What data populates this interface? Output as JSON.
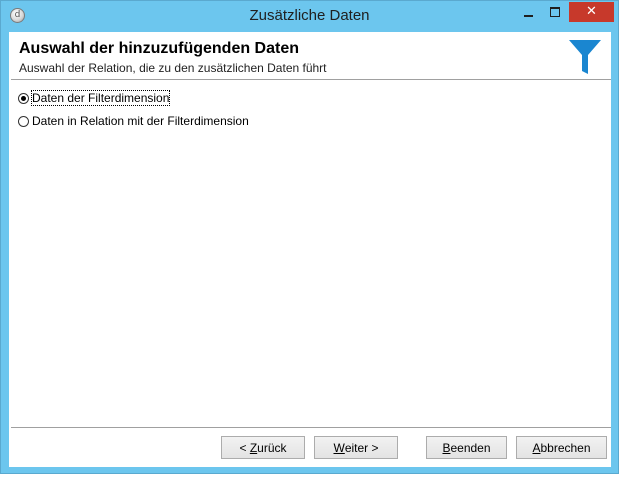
{
  "window": {
    "title": "Zusätzliche Daten",
    "controls": {
      "minimize": "minimize",
      "maximize": "maximize",
      "close": "✕"
    }
  },
  "header": {
    "title": "Auswahl der hinzuzufügenden Daten",
    "subtitle": "Auswahl der Relation, die zu den zusätzlichen Daten führt",
    "icon": "filter-icon",
    "icon_color": "#1a86d0"
  },
  "options": [
    {
      "label": "Daten der Filterdimension",
      "selected": true
    },
    {
      "label": "Daten in Relation mit der Filterdimension",
      "selected": false
    }
  ],
  "buttons": {
    "back": {
      "prefix": "< ",
      "mnemonic": "Z",
      "rest": "urück"
    },
    "next": {
      "prefix": "",
      "mnemonic": "W",
      "rest": "eiter >"
    },
    "finish": {
      "prefix": "",
      "mnemonic": "B",
      "rest": "eenden"
    },
    "cancel": {
      "prefix": "",
      "mnemonic": "A",
      "rest": "bbrechen"
    }
  },
  "colors": {
    "titlebar": "#6cc6ee",
    "close_button": "#c7392b"
  }
}
